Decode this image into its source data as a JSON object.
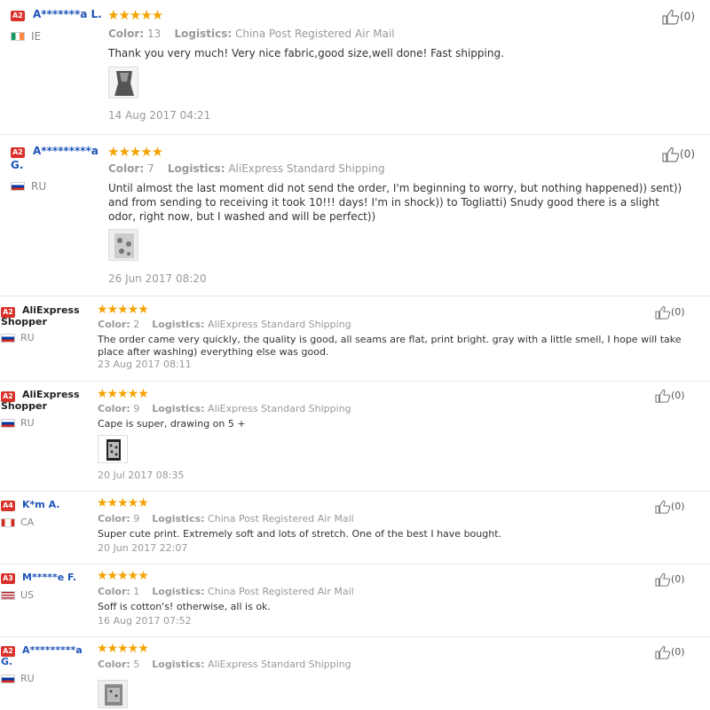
{
  "labels": {
    "color": "Color:",
    "logistics": "Logistics:"
  },
  "reviews": [
    {
      "badge": "A2",
      "name": "A*******a L.",
      "country": "IE",
      "stars": "★★★★★",
      "color": "13",
      "logistics": "China Post Registered Air Mail",
      "text": "Thank you very much! Very nice fabric,good size,well done! Fast shipping.",
      "date": "14 Aug 2017 04:21",
      "likes": "(0)"
    },
    {
      "badge": "A2",
      "name": "A*********a",
      "name2": "G.",
      "country": "RU",
      "stars": "★★★★★",
      "color": "7",
      "logistics": "AliExpress Standard Shipping",
      "text": "Until almost the last moment did not send the order, I'm beginning to worry, but nothing happened)) sent)) and from sending to receiving it took 10!!! days! I'm in shock)) to Togliatti) Snudy good there is a slight odor, right now, but I washed and will be perfect))",
      "date": "26 Jun 2017 08:20",
      "likes": "(0)"
    },
    {
      "badge": "A2",
      "name": "AliExpress",
      "name2": "Shopper",
      "country": "RU",
      "stars": "★★★★★",
      "color": "2",
      "logistics": "AliExpress Standard Shipping",
      "text": "The order came very quickly, the quality is good, all seams are flat, print bright. gray with a little smell, I hope will take place after washing) everything else was good.",
      "date": "23 Aug 2017 08:11",
      "likes": "(0)"
    },
    {
      "badge": "A2",
      "name": "AliExpress",
      "name2": "Shopper",
      "country": "RU",
      "stars": "★★★★★",
      "color": "9",
      "logistics": "AliExpress Standard Shipping",
      "text": "Cape is super, drawing on 5 +",
      "date": "20 Jul 2017 08:35",
      "likes": "(0)"
    },
    {
      "badge": "A4",
      "name": "K*m A.",
      "country": "CA",
      "stars": "★★★★★",
      "color": "9",
      "logistics": "China Post Registered Air Mail",
      "text": "Super cute print. Extremely soft and lots of stretch. One of the best I have bought.",
      "date": "20 Jun 2017 22:07",
      "likes": "(0)"
    },
    {
      "badge": "A3",
      "name": "M*****e F.",
      "country": "US",
      "stars": "★★★★★",
      "color": "1",
      "logistics": "China Post Registered Air Mail",
      "text": "Soff is cotton's! otherwise, all is ok.",
      "date": "16 Aug 2017 07:52",
      "likes": "(0)"
    },
    {
      "badge": "A2",
      "name": "A*********a",
      "name2": "G.",
      "country": "RU",
      "stars": "★★★★★",
      "color": "5",
      "logistics": "AliExpress Standard Shipping",
      "text": "",
      "date": "",
      "likes": "(0)"
    }
  ]
}
